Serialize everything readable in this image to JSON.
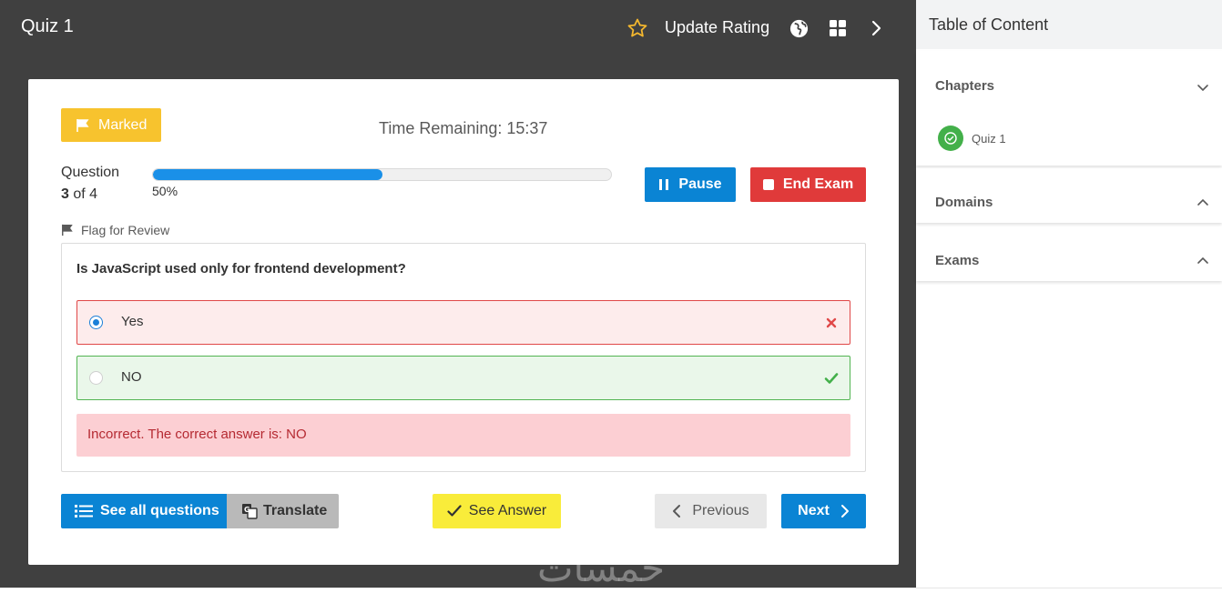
{
  "header": {
    "title": "Quiz 1",
    "rating_label": "Update Rating"
  },
  "quiz": {
    "marked_label": "Marked",
    "timer": "Time Remaining: 15:37",
    "question_label": "Question",
    "question_current": "3",
    "question_of": "of 4",
    "progress_percent": 50,
    "progress_text": "50%",
    "pause_label": "Pause",
    "end_label": "End Exam",
    "flag_label": "Flag for Review",
    "question_text": "Is JavaScript used only for frontend development?",
    "options": [
      {
        "label": "Yes",
        "selected": true,
        "status": "incorrect"
      },
      {
        "label": "NO",
        "selected": false,
        "status": "correct"
      }
    ],
    "feedback": "Incorrect. The correct answer is: NO",
    "see_all_label": "See all questions",
    "translate_label": "Translate",
    "see_answer_label": "See Answer",
    "previous_label": "Previous",
    "next_label": "Next"
  },
  "sidebar": {
    "title": "Table of Content",
    "sections": [
      {
        "label": "Chapters",
        "expanded": true,
        "items": [
          {
            "label": "Quiz 1",
            "completed": true
          }
        ]
      },
      {
        "label": "Domains",
        "expanded": false
      },
      {
        "label": "Exams",
        "expanded": false
      }
    ]
  },
  "watermark": "خمسات",
  "colors": {
    "dark_bg": "#404040",
    "primary": "#0a84d4",
    "danger": "#e03a3a",
    "marked": "#f7c32e",
    "see_answer": "#f9ec3a",
    "success": "#43b04a"
  }
}
